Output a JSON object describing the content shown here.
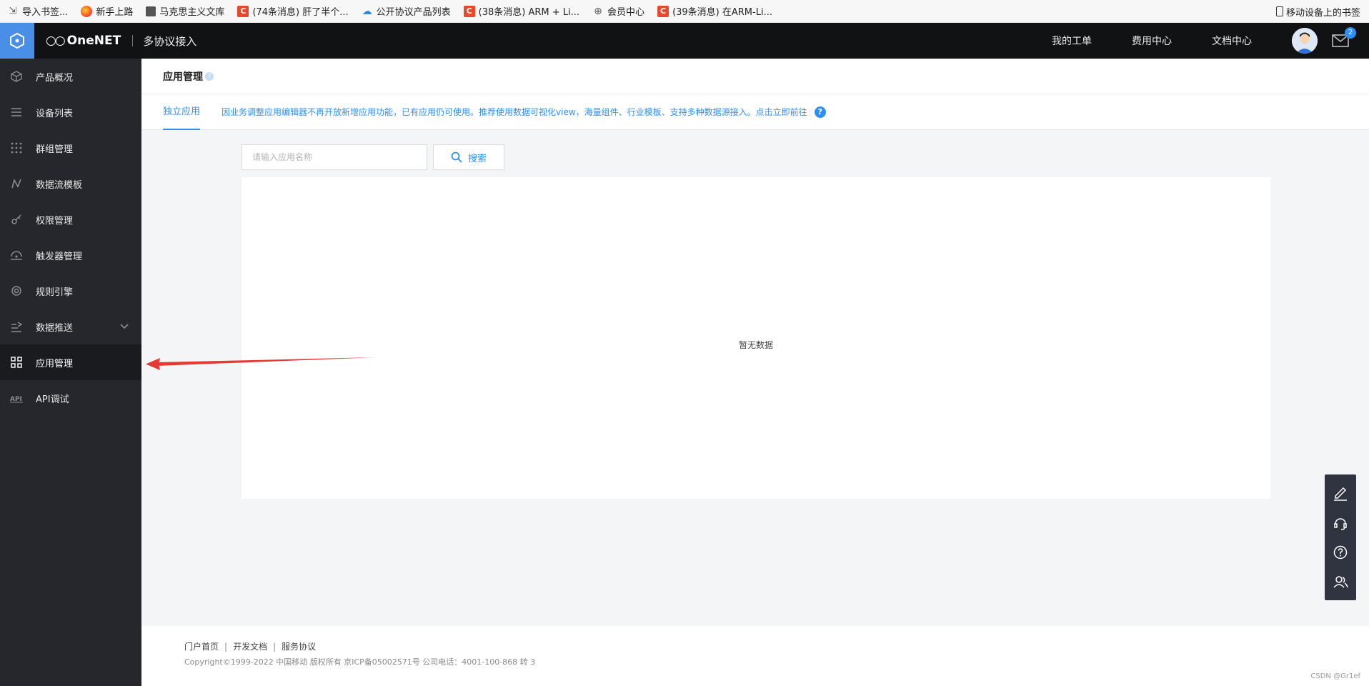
{
  "bookmarks": {
    "items": [
      {
        "label": "导入书签...",
        "icon": "import-icon"
      },
      {
        "label": "新手上路",
        "icon": "firefox-icon"
      },
      {
        "label": "马克思主义文库",
        "icon": "book-icon"
      },
      {
        "label": "(74条消息) 肝了半个...",
        "icon": "csdn-icon"
      },
      {
        "label": "公开协议产品列表",
        "icon": "cloud-icon"
      },
      {
        "label": "(38条消息) ARM + Li...",
        "icon": "csdn-icon"
      },
      {
        "label": "会员中心",
        "icon": "globe-icon"
      },
      {
        "label": "(39条消息) 在ARM-Li...",
        "icon": "csdn-icon"
      }
    ],
    "mobile": "移动设备上的书签"
  },
  "header": {
    "brand": "OneNET",
    "subtitle": "多协议接入",
    "nav": [
      "我的工单",
      "费用中心",
      "文档中心"
    ],
    "mail_badge": "2"
  },
  "sidebar": {
    "items": [
      {
        "label": "产品概况",
        "icon": "cube-icon"
      },
      {
        "label": "设备列表",
        "icon": "list-icon"
      },
      {
        "label": "群组管理",
        "icon": "grid-dots-icon"
      },
      {
        "label": "数据流模板",
        "icon": "dataflow-icon"
      },
      {
        "label": "权限管理",
        "icon": "key-icon"
      },
      {
        "label": "触发器管理",
        "icon": "trigger-icon"
      },
      {
        "label": "规则引擎",
        "icon": "rule-icon"
      },
      {
        "label": "数据推送",
        "icon": "push-icon"
      },
      {
        "label": "应用管理",
        "icon": "apps-icon"
      },
      {
        "label": "API调试",
        "icon": "api-icon"
      }
    ],
    "active_index": 8
  },
  "page": {
    "title": "应用管理",
    "tab": "独立应用",
    "notice": "因业务调整应用编辑器不再开放新增应用功能，已有应用仍可使用。推荐使用数据可视化view，海量组件、行业模板、支持多种数据源接入。点击立即前往",
    "search_placeholder": "请输入应用名称",
    "search_button": "搜索",
    "empty_text": "暂无数据"
  },
  "footer": {
    "links": [
      "门户首页",
      "开发文档",
      "服务协议"
    ],
    "copyright": "Copyright©1999-2022 中国移动 版权所有 京ICP备05002571号 公司电话：4001-100-868 转 3"
  },
  "watermark": "CSDN @Gr1ef",
  "colors": {
    "accent": "#2e8ff5",
    "sidebar_bg": "#25272c",
    "topbar_bg": "#111214",
    "arrow": "#e53935"
  }
}
